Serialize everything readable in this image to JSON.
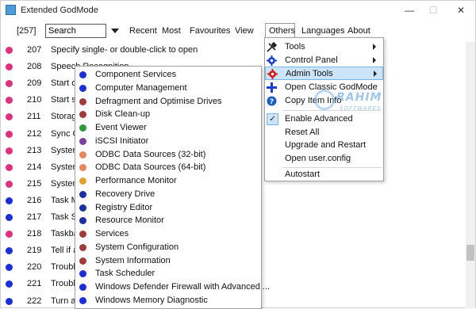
{
  "window": {
    "title": "Extended GodMode"
  },
  "toolbar": {
    "count": "[257]",
    "search_value": "Search",
    "tabs": [
      "Recent",
      "Most",
      "Favourites",
      "View",
      "Others",
      "Languages",
      "About"
    ]
  },
  "rows": [
    {
      "num": "207",
      "text": "Specify single- or double-click to open",
      "color": "#e0317f"
    },
    {
      "num": "208",
      "text": "Speech Recognition",
      "color": "#e0317f"
    },
    {
      "num": "209",
      "text": "Start on",
      "color": "#e0317f"
    },
    {
      "num": "210",
      "text": "Start sp",
      "color": "#e0317f"
    },
    {
      "num": "211",
      "text": "Storage",
      "color": "#e0317f"
    },
    {
      "num": "212",
      "text": "Sync Ce",
      "color": "#e0317f"
    },
    {
      "num": "213",
      "text": "System",
      "color": "#e0317f"
    },
    {
      "num": "214",
      "text": "System",
      "color": "#e0317f"
    },
    {
      "num": "215",
      "text": "System",
      "color": "#e0317f"
    },
    {
      "num": "216",
      "text": "Task Ma",
      "color": "#1a2fd6"
    },
    {
      "num": "217",
      "text": "Task Sc",
      "color": "#1a2fd6"
    },
    {
      "num": "218",
      "text": "Taskbar",
      "color": "#e0317f"
    },
    {
      "num": "219",
      "text": "Tell if ar",
      "color": "#1a2fd6"
    },
    {
      "num": "220",
      "text": "Trouble",
      "color": "#1a2fd6"
    },
    {
      "num": "221",
      "text": "Trouble",
      "color": "#1a2fd6"
    },
    {
      "num": "222",
      "text": "Turn au",
      "color": "#1a2fd6"
    }
  ],
  "admin_tools": [
    {
      "label": "Component Services",
      "color": "#1a2fd6"
    },
    {
      "label": "Computer Management",
      "color": "#1a2fd6"
    },
    {
      "label": "Defragment and Optimise Drives",
      "color": "#a33a3a"
    },
    {
      "label": "Disk Clean-up",
      "color": "#a33a3a"
    },
    {
      "label": "Event Viewer",
      "color": "#2a9a3a"
    },
    {
      "label": "iSCSI Initiator",
      "color": "#7b3fa0"
    },
    {
      "label": "ODBC Data Sources (32-bit)",
      "color": "#e8885a"
    },
    {
      "label": "ODBC Data Sources (64-bit)",
      "color": "#e8885a"
    },
    {
      "label": "Performance Monitor",
      "color": "#e0a030"
    },
    {
      "label": "Recovery Drive",
      "color": "#1a2fa0"
    },
    {
      "label": "Registry Editor",
      "color": "#1a2fa0"
    },
    {
      "label": "Resource Monitor",
      "color": "#1a2fa0"
    },
    {
      "label": "Services",
      "color": "#a33a3a"
    },
    {
      "label": "System Configuration",
      "color": "#a33a3a"
    },
    {
      "label": "System Information",
      "color": "#a33a3a"
    },
    {
      "label": "Task Scheduler",
      "color": "#1a2fd6"
    },
    {
      "label": "Windows Defender Firewall with Advanced ...",
      "color": "#1a2fd6"
    },
    {
      "label": "Windows Memory Diagnostic",
      "color": "#1a2fd6"
    }
  ],
  "others_menu": {
    "tools": "Tools",
    "control_panel": "Control Panel",
    "admin_tools": "Admin Tools",
    "open_classic": "Open Classic GodMode",
    "copy_item_info": "Copy Item Info",
    "enable_advanced": "Enable Advanced",
    "reset_all": "Reset All",
    "upgrade_restart": "Upgrade and Restart",
    "open_user_config": "Open user.config",
    "autostart": "Autostart"
  },
  "watermark": {
    "line1": "RAHIM",
    "line2": "SOFTWARES"
  },
  "icons": {
    "tools": "wrench-screwdriver-icon",
    "control_panel": "gear-icon",
    "admin_tools": "red-gear-icon",
    "open_classic": "plus-icon",
    "copy_item_info": "question-icon",
    "enable_advanced": "check-icon"
  }
}
